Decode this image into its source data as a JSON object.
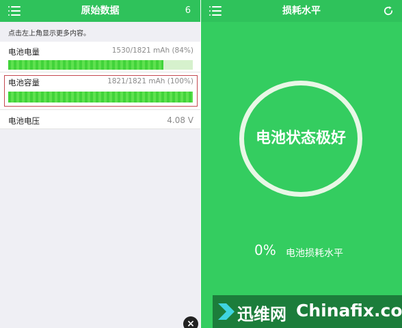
{
  "left_panel": {
    "title": "原始数据",
    "count": "6",
    "hint": "点击左上角显示更多内容。",
    "rows": [
      {
        "label": "电池电量",
        "value": "1530/1821 mAh (84%)",
        "fill": 0.84
      },
      {
        "label": "电池容量",
        "value": "1821/1821 mAh (100%)",
        "fill": 1.0
      },
      {
        "label": "电池电压",
        "value": "4.08 V"
      }
    ],
    "close_icon": "close-icon"
  },
  "right_panel": {
    "title": "损耗水平",
    "status_text": "电池状态极好",
    "wear_percent": "0%",
    "wear_label": "电池损耗水平"
  },
  "watermark": {
    "cn_text": "迅维网",
    "en_text": "Chinafix.com"
  },
  "colors": {
    "header_green": "#2fc25b",
    "panel_green": "#34cd60",
    "bar_green": "#41d33a",
    "selection_red": "#c4484f"
  }
}
